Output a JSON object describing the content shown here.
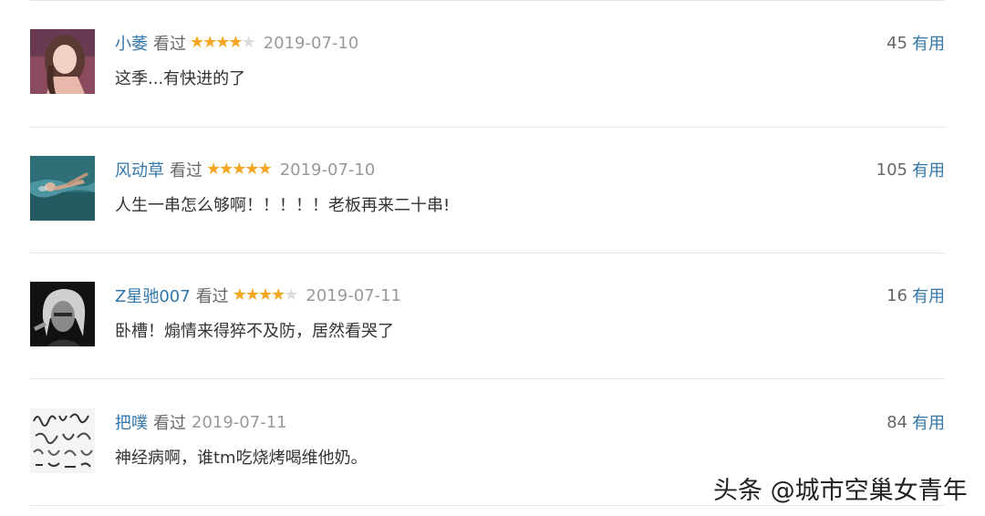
{
  "comments": [
    {
      "user": "小萎",
      "status": "看过",
      "rating": 4,
      "date": "2019-07-10",
      "text": "这季...有快进的了",
      "votes": "45",
      "useful_label": "有用",
      "avatar_icon": "woman-portrait-avatar"
    },
    {
      "user": "风动草",
      "status": "看过",
      "rating": 5,
      "date": "2019-07-10",
      "text": "人生一串怎么够啊！！！！！老板再来二十串!",
      "votes": "105",
      "useful_label": "有用",
      "avatar_icon": "swimmer-avatar"
    },
    {
      "user": "Z星驰007",
      "status": "看过",
      "rating": 4,
      "date": "2019-07-11",
      "text": "卧槽！煽情来得猝不及防，居然看哭了",
      "votes": "16",
      "useful_label": "有用",
      "avatar_icon": "bw-man-portrait-avatar"
    },
    {
      "user": "把噗",
      "status": "看过",
      "rating": 0,
      "date": "2019-07-11",
      "text": "神经病啊，谁tm吃烧烤喝维他奶。",
      "votes": "84",
      "useful_label": "有用",
      "avatar_icon": "sketch-doodle-avatar"
    }
  ],
  "watermark": "头条 @城市空巢女青年",
  "colors": {
    "link": "#3377aa",
    "star_on": "#f6a623",
    "star_off": "#dcdcdc",
    "date": "#999999",
    "text": "#333333",
    "divider": "#e5e5e5"
  }
}
